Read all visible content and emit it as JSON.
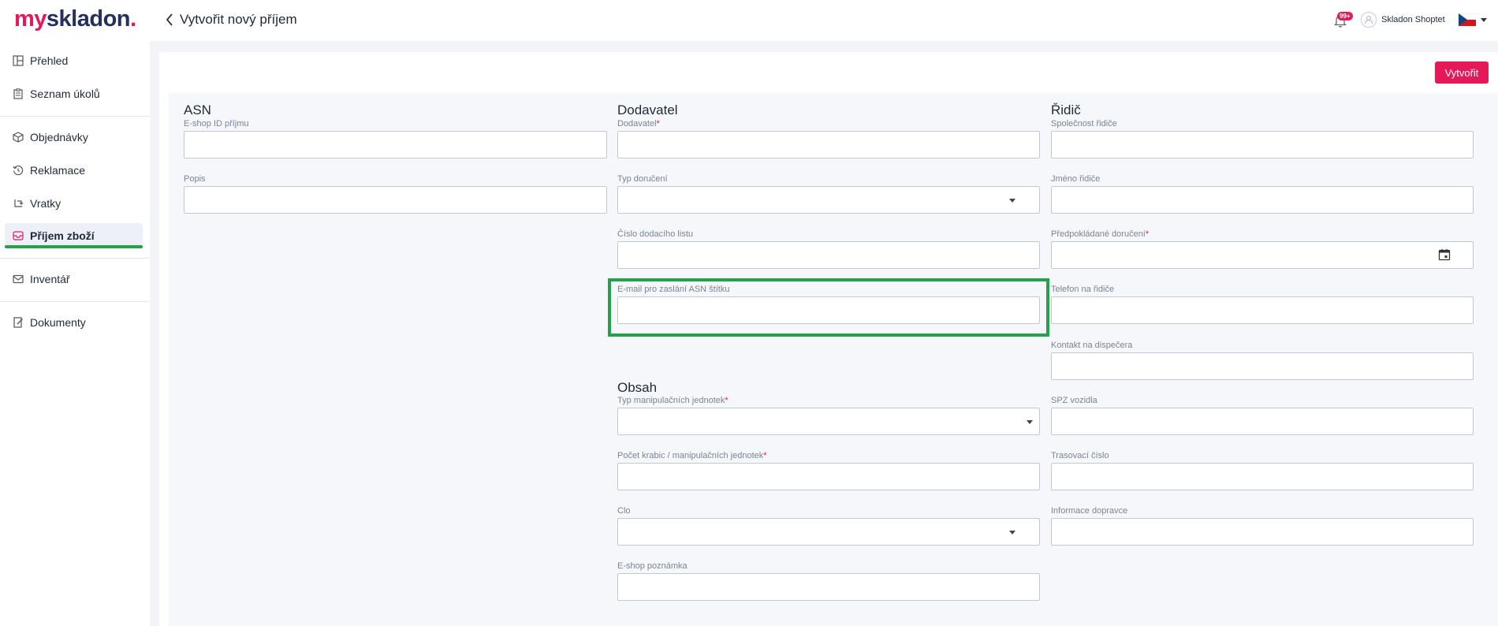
{
  "app": {
    "logo": {
      "part1": "my",
      "part2": "skladon",
      "dot": "."
    },
    "brand_color": "#e3195a",
    "highlight_color": "#22a34a"
  },
  "sidebar": {
    "items": [
      {
        "label": "Přehled",
        "icon": "dashboard-icon"
      },
      {
        "label": "Seznam úkolů",
        "icon": "clipboard-icon"
      },
      {
        "label": "Objednávky",
        "icon": "box-icon"
      },
      {
        "label": "Reklamace",
        "icon": "history-icon"
      },
      {
        "label": "Vratky",
        "icon": "return-icon"
      },
      {
        "label": "Příjem zboží",
        "icon": "inbox-icon",
        "active": true
      },
      {
        "label": "Inventář",
        "icon": "mail-icon"
      },
      {
        "label": "Dokumenty",
        "icon": "document-icon"
      }
    ]
  },
  "header": {
    "title": "Vytvořit nový příjem",
    "notifications_badge": "99+",
    "user_name": "Skladon Shoptet",
    "language": "CZ"
  },
  "actions": {
    "create_label": "Vytvořit"
  },
  "form": {
    "asn": {
      "title": "ASN",
      "eshop_id_label": "E-shop ID příjmu",
      "description_label": "Popis"
    },
    "supplier": {
      "title": "Dodavatel",
      "supplier_label": "Dodavatel",
      "delivery_type_label": "Typ doručení",
      "delivery_note_label": "Číslo dodacího listu",
      "email_label": "E-mail pro zaslání ASN štítku"
    },
    "content": {
      "title": "Obsah",
      "unit_type_label": "Typ manipulačních jednotek",
      "box_count_label": "Počet krabic / manipulačních jednotek",
      "customs_label": "Clo",
      "eshop_note_label": "E-shop poznámka"
    },
    "driver": {
      "title": "Řidič",
      "company_label": "Společnost řidiče",
      "name_label": "Jméno řidiče",
      "expected_delivery_label": "Předpokládané doručení",
      "phone_label": "Telefon na řidiče",
      "dispatcher_label": "Kontakt na dispečera",
      "plate_label": "SPZ vozidla",
      "tracking_label": "Trasovací číslo",
      "carrier_info_label": "Informace dopravce"
    },
    "required_mark": "*"
  }
}
